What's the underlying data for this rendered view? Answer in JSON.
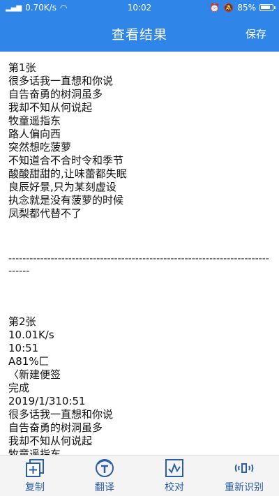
{
  "status": {
    "signal": "4G",
    "speed": "0.70K/s",
    "time": "10:02",
    "battery": "85%"
  },
  "header": {
    "title": "查看结果",
    "save_label": "保存"
  },
  "result": {
    "block1": [
      "第1张",
      "很多话我一直想和你说",
      "自告奋勇的树洞虽多",
      "我却不知从何说起",
      "牧童遥指东",
      "路人偏向西",
      "突然想吃菠萝",
      "不知道合不合时令和季节",
      "酸酸甜甜的,让味蕾都失眠",
      "良辰好景,只为某刻虚设",
      "执念就是没有菠萝的时候",
      "凤梨都代替不了"
    ],
    "divider": "--------------------------------------------------------------------------------",
    "block2": [
      "第2张",
      "10.01K/s",
      "10:51",
      "A81%匚",
      "〈新建便签",
      "完成",
      "2019/1/310:51",
      "很多话我一直想和你说",
      "自告奋勇的树洞虽多",
      "我却不知从何说起",
      "牧童遥指东"
    ]
  },
  "toolbar": {
    "items": [
      {
        "label": "复制",
        "icon": "copy-add-icon"
      },
      {
        "label": "翻译",
        "icon": "translate-icon"
      },
      {
        "label": "校对",
        "icon": "proofread-icon"
      },
      {
        "label": "重新识别",
        "icon": "rescan-icon"
      }
    ]
  },
  "colors": {
    "primary": "#2f86e8",
    "toolbar_icon": "#2a5ea8"
  }
}
